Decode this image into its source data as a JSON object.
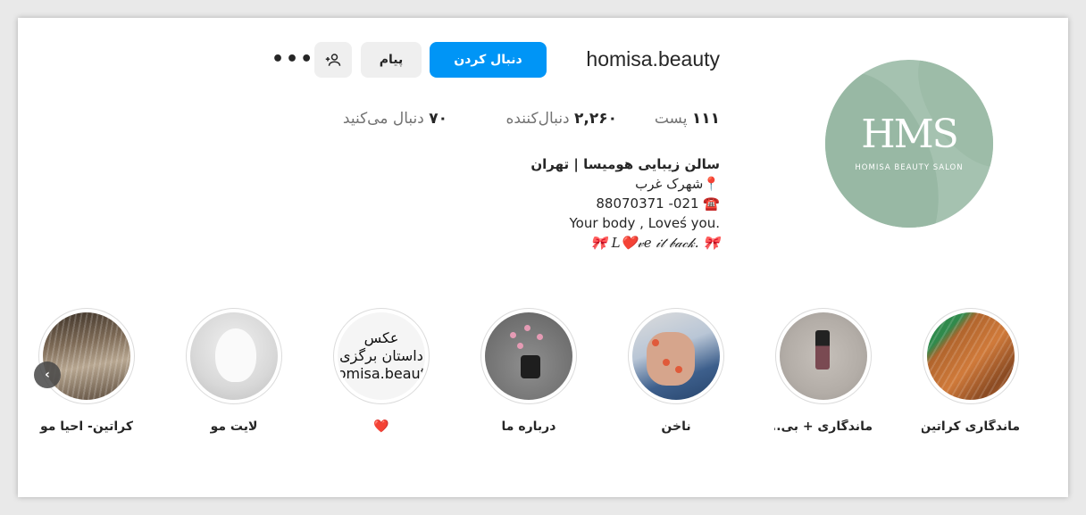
{
  "profile": {
    "username": "homisa.beauty",
    "avatar_monogram": "HMS",
    "avatar_subtitle": "HOMISA BEAUTY SALON"
  },
  "actions": {
    "follow_label": "دنبال کردن",
    "message_label": "پیام",
    "add_user_icon": "add-user-icon",
    "more_label": "•••"
  },
  "stats": {
    "posts_count": "۱۱۱",
    "posts_label": "پست",
    "followers_count": "۲,۲۶۰",
    "followers_label": "دنبال‌کننده",
    "following_count": "۷۰",
    "following_label": "دنبال می‌کنید"
  },
  "bio": {
    "name": "سالن زیبایی هومیسا | تهران",
    "location": "📍شهرک غرب",
    "phone": "☎️ 021- 88070371",
    "tagline1": ".Your body , Loveś you",
    "tagline2": "🎀 .L❤️𝓋𝑒 𝒾𝓉 𝒷𝒶𝒸𝓀 🎀"
  },
  "highlights": [
    {
      "label": "ماندگاری کراتین"
    },
    {
      "label": "ماندگاری + بی..."
    },
    {
      "label": "ناخن"
    },
    {
      "label": "درباره ما"
    },
    {
      "label": "❤️",
      "cover_text": "عکس\nداستان برگزی\nhomisa.beauty"
    },
    {
      "label": "لایت مو"
    },
    {
      "label": "کراتین- احیا مو"
    }
  ],
  "colors": {
    "accent": "#0095f6",
    "avatar_bg": "#a5c2b0",
    "secondary_button": "#efefef"
  }
}
